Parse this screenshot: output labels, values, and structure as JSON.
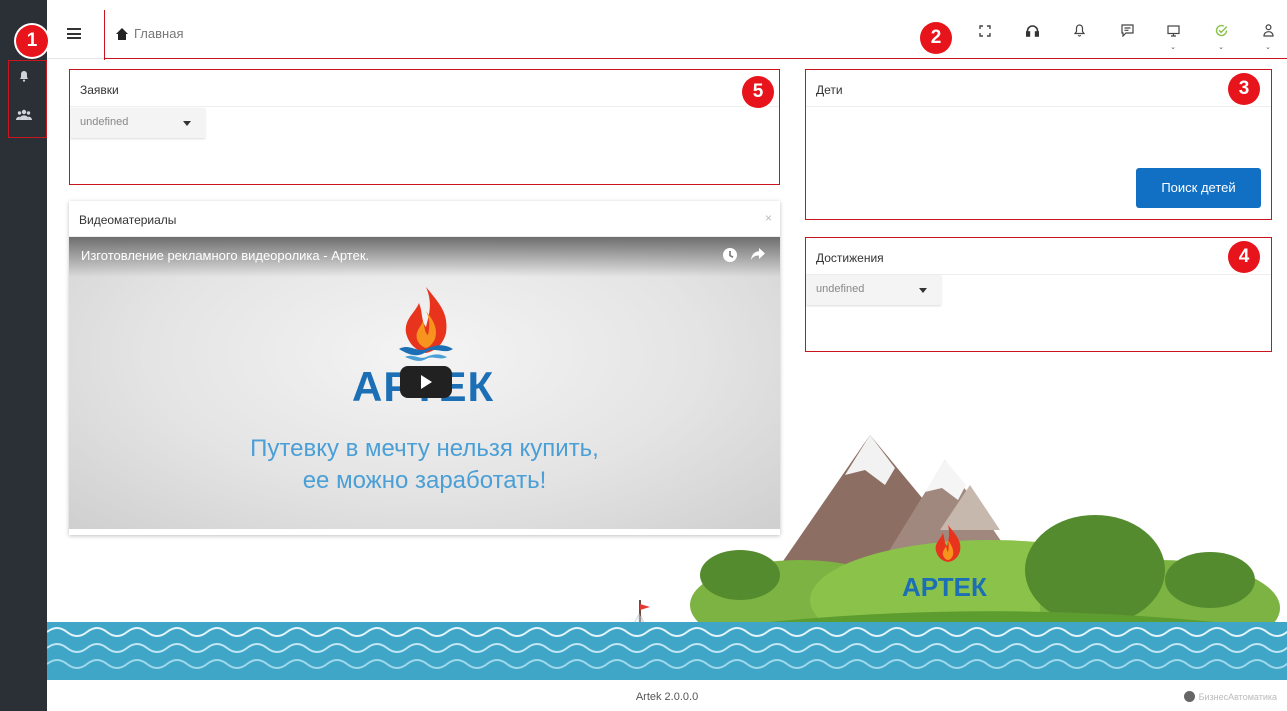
{
  "app": {
    "version": "Artek 2.0.0.0",
    "brand": "БизнесАвтоматика"
  },
  "markers": [
    "1",
    "2",
    "3",
    "4",
    "5"
  ],
  "breadcrumb": {
    "icon": "home-icon",
    "label": "Главная"
  },
  "topbar": {
    "icons": [
      "fullscreen-icon",
      "headset-icon",
      "bell-icon",
      "chat-icon",
      "monitor-icon",
      "check-circle-icon",
      "user-icon"
    ]
  },
  "sidebar": {
    "icons": [
      "bell-icon",
      "users-icon"
    ]
  },
  "panels": {
    "requests": {
      "title": "Заявки",
      "dropdown_value": "undefined"
    },
    "children": {
      "title": "Дети",
      "button_label": "Поиск детей"
    },
    "achievements": {
      "title": "Достижения",
      "dropdown_value": "undefined"
    }
  },
  "video_panel": {
    "title": "Видеоматериалы",
    "close_label": "×",
    "video_title": "Изготовление рекламного видеоролика - Артек.",
    "logo_text": "АРТЕК",
    "slogan_line1": "Путевку в мечту нельзя купить,",
    "slogan_line2": "ее можно заработать!"
  },
  "scenery": {
    "island_logo_text": "АРТЕК"
  },
  "colors": {
    "accent": "#1270c4",
    "marker": "#e8141c",
    "frame": "#c9151e",
    "sidebar": "#2b2f36",
    "sea": "#3fa6c8"
  }
}
